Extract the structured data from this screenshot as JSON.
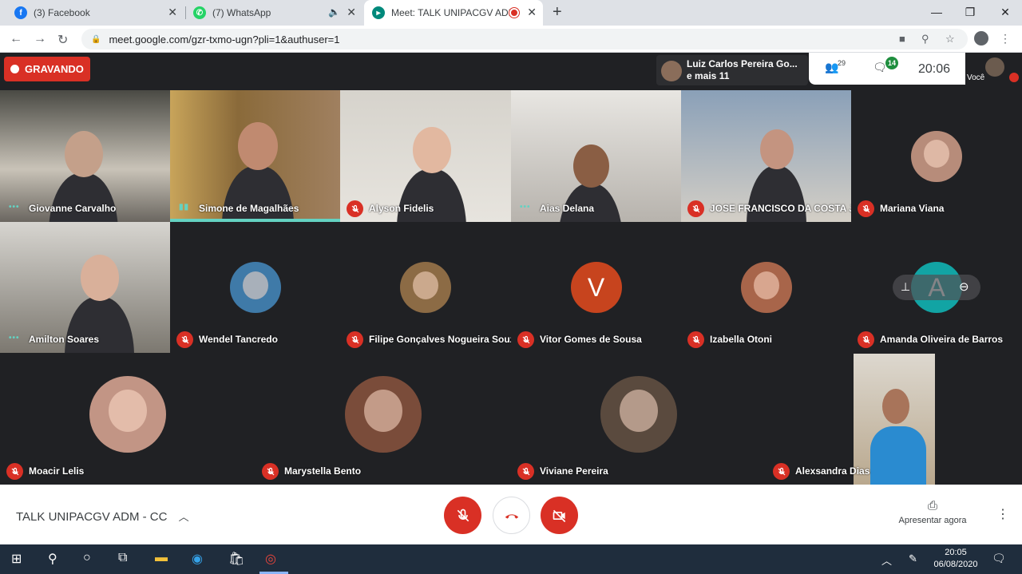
{
  "browser": {
    "tabs": [
      {
        "label": "(3) Facebook",
        "icon": "facebook-icon",
        "color": "#1877f2"
      },
      {
        "label": "(7) WhatsApp",
        "icon": "whatsapp-icon",
        "color": "#25d366"
      },
      {
        "label": "Meet: TALK UNIPACGV ADM",
        "icon": "meet-icon",
        "color": "#00897b"
      }
    ],
    "new_tab": "+",
    "url": "meet.google.com/gzr-txmo-ugn?pli=1&authuser=1"
  },
  "meeting": {
    "recording_label": "GRAVANDO",
    "presenter_line1": "Luiz Carlos Pereira Go...",
    "presenter_line2": "e mais 11",
    "people_count": "29",
    "chat_count": "14",
    "time": "20:06",
    "self_label": "Você",
    "title": "TALK UNIPACGV ADM - CC",
    "present_label": "Apresentar agora"
  },
  "participants": [
    {
      "name": "Giovanne Carvalho",
      "state": "speaking-dots"
    },
    {
      "name": "Simone de Magalhães",
      "state": "speaking"
    },
    {
      "name": "Alyson Fidelis",
      "state": "muted"
    },
    {
      "name": "Aias Delana",
      "state": "speaking-dots"
    },
    {
      "name": "JOSE FRANCISCO DA COSTA J...",
      "state": "muted"
    },
    {
      "name": "Mariana Viana",
      "state": "muted"
    },
    {
      "name": "Amilton Soares",
      "state": "speaking-dots"
    },
    {
      "name": "Wendel Tancredo",
      "state": "muted"
    },
    {
      "name": "Filipe Gonçalves Nogueira Souza",
      "state": "muted"
    },
    {
      "name": "Vitor Gomes de Sousa",
      "state": "muted",
      "initial": "V",
      "avatar_color": "#c7441e"
    },
    {
      "name": "Izabella Otoni",
      "state": "muted"
    },
    {
      "name": "Amanda Oliveira de Barros",
      "state": "muted",
      "initial": "A",
      "avatar_color": "#12a4a4"
    },
    {
      "name": "Moacir Lelis",
      "state": "muted"
    },
    {
      "name": "Marystella Bento",
      "state": "muted"
    },
    {
      "name": "Viviane Pereira",
      "state": "muted"
    },
    {
      "name": "Alexsandra Dias",
      "state": "muted"
    }
  ],
  "taskbar": {
    "time": "20:05",
    "date": "06/08/2020"
  }
}
